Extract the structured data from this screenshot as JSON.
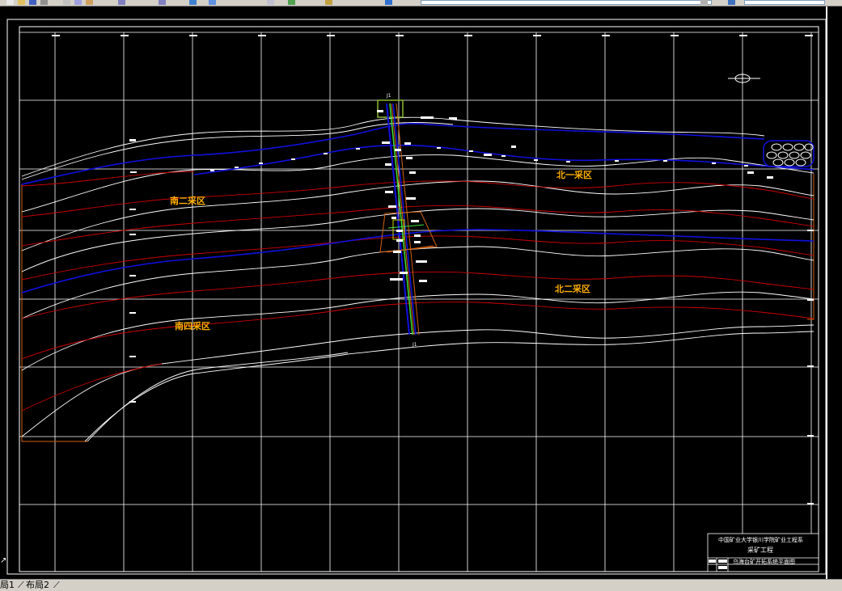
{
  "toolbar": {
    "layer_combo": "",
    "style_combo": "",
    "tools": [
      "new-icon",
      "open-icon",
      "save-icon",
      "print-icon",
      "cut-icon",
      "copy-icon",
      "paste-icon",
      "undo-icon",
      "redo-icon",
      "pan-icon",
      "zoom-icon",
      "properties-icon",
      "layers-icon",
      "match-icon",
      "help-icon"
    ]
  },
  "drawing": {
    "zones": {
      "north1": "北一采区",
      "north2": "北二采区",
      "south2": "南二采区",
      "south4": "南四采区"
    },
    "shaft_label_top": "J1",
    "shaft_label_bottom": "J1"
  },
  "title_block": {
    "line1": "中国矿业大学银川学院矿业工程系",
    "line2": "采矿工程",
    "line3": "乌海台矿开拓系统平面图"
  },
  "layout_tabs": {
    "tab1": "局1",
    "tab2": "布局2"
  },
  "colors": {
    "background": "#000000",
    "grid": "#ffffff",
    "seam_red": "#cc0000",
    "seam_blue": "#1010e0",
    "zone_label": "#ffb000",
    "frame_orange": "#d06010",
    "shaft_green": "#3ce03c"
  }
}
